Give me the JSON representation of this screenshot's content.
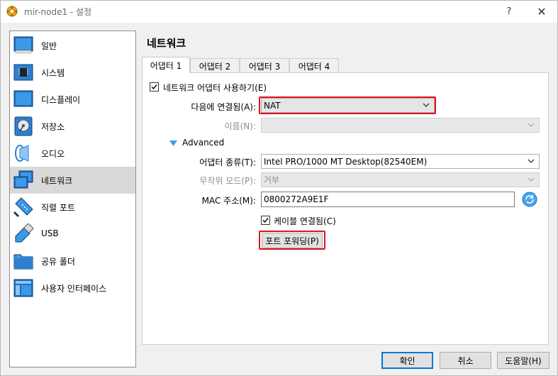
{
  "window": {
    "title": "mir-node1 - 설정",
    "help_label": "?",
    "close_label": "✕"
  },
  "sidebar": {
    "items": [
      {
        "label": "일반",
        "icon": "general-icon"
      },
      {
        "label": "시스템",
        "icon": "chip-icon"
      },
      {
        "label": "디스플레이",
        "icon": "monitor-icon"
      },
      {
        "label": "저장소",
        "icon": "disk-icon"
      },
      {
        "label": "오디오",
        "icon": "speaker-icon"
      },
      {
        "label": "네트워크",
        "icon": "network-icon"
      },
      {
        "label": "직렬 포트",
        "icon": "serial-port-icon"
      },
      {
        "label": "USB",
        "icon": "usb-icon"
      },
      {
        "label": "공유 폴더",
        "icon": "folder-icon"
      },
      {
        "label": "사용자 인터페이스",
        "icon": "ui-icon"
      }
    ],
    "selected": "네트워크"
  },
  "page": {
    "title": "네트워크",
    "tabs": [
      {
        "label": "어댑터 1"
      },
      {
        "label": "어댑터 2"
      },
      {
        "label": "어댑터 3"
      },
      {
        "label": "어댑터 4"
      }
    ],
    "active_tab": "어댑터 1"
  },
  "adapter": {
    "enable_label": "네트워크 어댑터 사용하기(E)",
    "enable_checked": true,
    "attached_label": "다음에 연결됨(A):",
    "attached_value": "NAT",
    "name_label": "이름(N):",
    "name_value": "",
    "advanced_label": "Advanced",
    "type_label": "어댑터 종류(T):",
    "type_value": "Intel PRO/1000 MT Desktop(82540EM)",
    "promisc_label": "무작위 모드(P):",
    "promisc_value": "거부",
    "mac_label": "MAC 주소(M):",
    "mac_value": "0800272A9E1F",
    "cable_label": "케이블 연결됨(C)",
    "cable_checked": true,
    "port_forward_label": "포트 포워딩(P)"
  },
  "footer": {
    "ok_label": "확인",
    "cancel_label": "취소",
    "help_label": "도움말(H)"
  },
  "colors": {
    "highlight": "#e1121c",
    "selected_bg": "#d9d9d9",
    "accent": "#0078d7"
  }
}
